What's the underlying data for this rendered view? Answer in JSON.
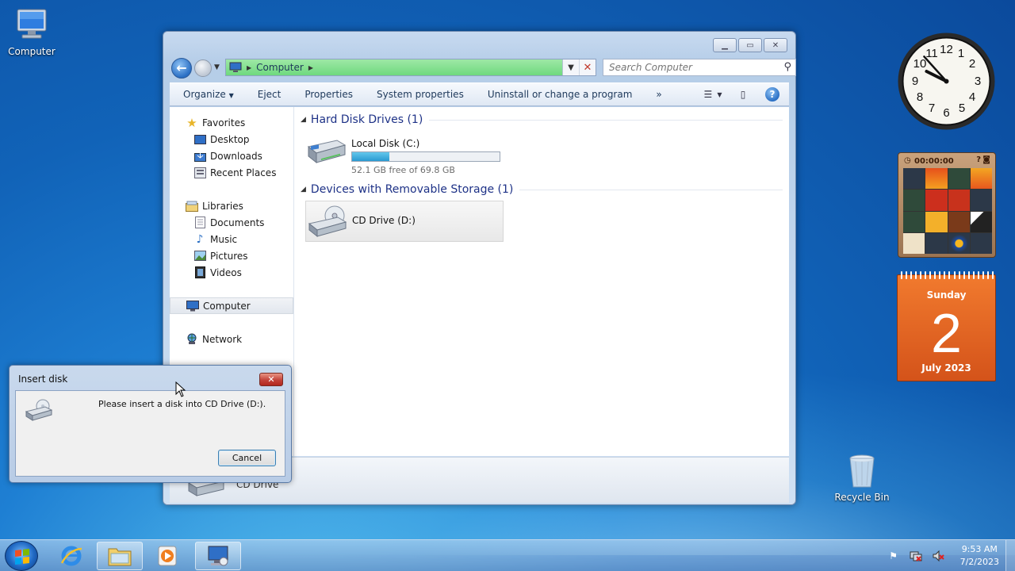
{
  "desktop": {
    "icons": [
      {
        "label": "Computer"
      },
      {
        "label": "Recycle Bin"
      }
    ]
  },
  "explorer": {
    "address": {
      "crumb": "Computer"
    },
    "search": {
      "placeholder": "Search Computer"
    },
    "toolbar": {
      "organize": "Organize",
      "eject": "Eject",
      "properties": "Properties",
      "system_properties": "System properties",
      "uninstall": "Uninstall or change a program",
      "more": "»"
    },
    "nav": {
      "favorites": "Favorites",
      "desktop": "Desktop",
      "downloads": "Downloads",
      "recent": "Recent Places",
      "libraries": "Libraries",
      "documents": "Documents",
      "music": "Music",
      "pictures": "Pictures",
      "videos": "Videos",
      "computer": "Computer",
      "network": "Network"
    },
    "groups": {
      "hdd": "Hard Disk Drives (1)",
      "removable": "Devices with Removable Storage (1)"
    },
    "drives": {
      "c_name": "Local Disk (C:)",
      "c_free": "52.1 GB free of 69.8 GB",
      "c_used_fraction": 0.253,
      "d_name": "CD Drive (D:)"
    },
    "details": {
      "label": "CD Drive"
    }
  },
  "dialog": {
    "title": "Insert disk",
    "close": "✕",
    "message": "Please insert a disk into CD Drive (D:).",
    "cancel": "Cancel"
  },
  "gadgets": {
    "clock": {
      "hour": 9,
      "minute": 53
    },
    "puzzle": {
      "timer": "00:00:00"
    },
    "calendar": {
      "weekday": "Sunday",
      "day": "2",
      "month": "July 2023"
    }
  },
  "taskbar": {
    "time": "9:53 AM",
    "date": "7/2/2023"
  },
  "colors": {
    "accent": "#1e3287",
    "address_green": "#6fd97e",
    "calendar_orange": "#e8652a"
  }
}
